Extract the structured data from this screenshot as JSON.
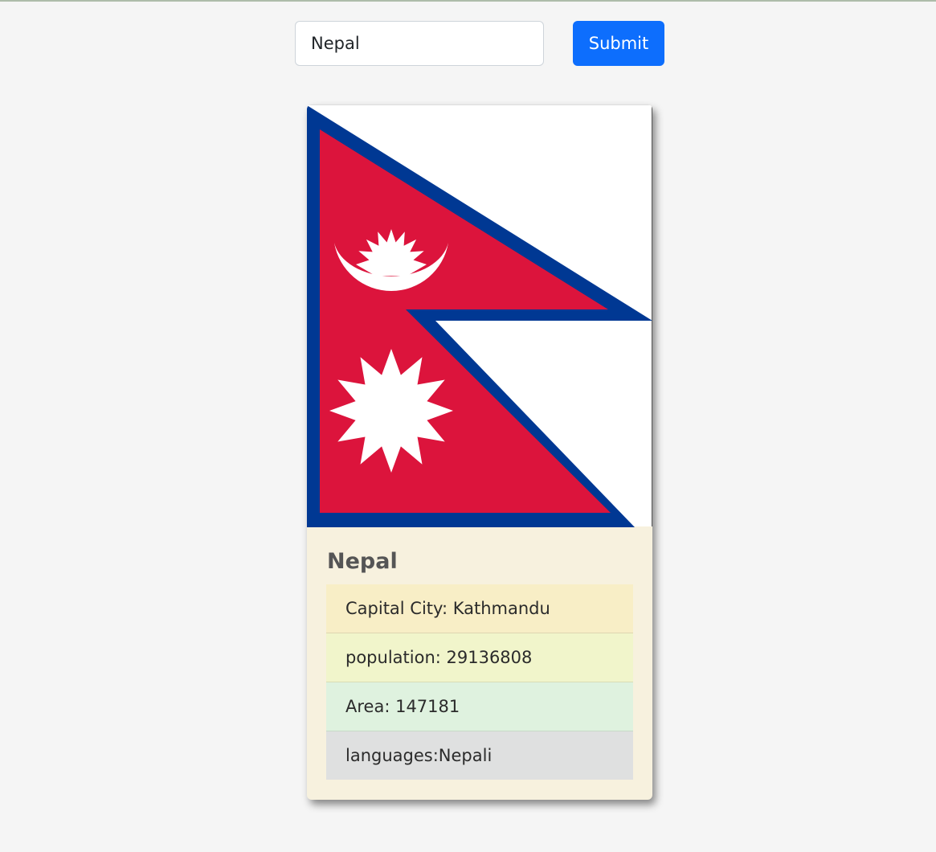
{
  "search": {
    "value": "Nepal",
    "submit_label": "Submit"
  },
  "country": {
    "name": "Nepal",
    "flag_colors": {
      "crimson": "#DC143C",
      "border_blue": "#003893",
      "emblem": "#FFFFFF"
    },
    "details": {
      "capital": "Capital City: Kathmandu",
      "population": "population: 29136808",
      "area": "Area: 147181",
      "languages": "languages:Nepali"
    }
  },
  "colors": {
    "page_background": "#f5f5f5",
    "primary_button": "#0d6efd",
    "card_background": "#f7f1de"
  }
}
